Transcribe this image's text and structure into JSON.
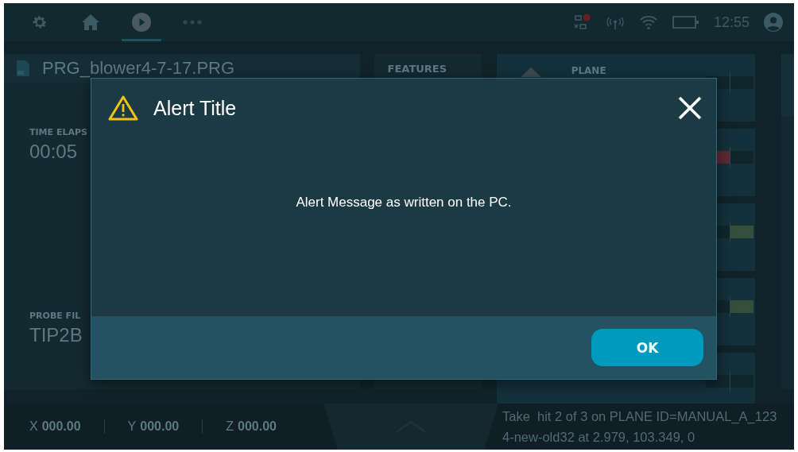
{
  "nav_tabs": [
    {
      "kind": "settings",
      "selected": false
    },
    {
      "kind": "home",
      "selected": false
    },
    {
      "kind": "run",
      "selected": true
    },
    {
      "kind": "more",
      "selected": false
    }
  ],
  "status": {
    "network_alert": true,
    "time": "12:55"
  },
  "program": {
    "file_name": "PRG_blower4-7-17.PRG",
    "time_label": "TIME ELAPS",
    "time_value": "00:05",
    "probe_label": "PROBE FIL",
    "probe_value": "TIP2B"
  },
  "features": {
    "heading": "FEATURES"
  },
  "feature_cards": [
    {
      "kind": "plain",
      "label": "PLANE",
      "arrow": true
    },
    {
      "kind": "low",
      "color": "#5a2a30"
    },
    {
      "kind": "high",
      "color": "#34503c"
    },
    {
      "kind": "high",
      "color": "#34503c"
    },
    {
      "kind": "plain"
    }
  ],
  "coordinates": [
    {
      "axis": "X",
      "value": "000.00"
    },
    {
      "axis": "Y",
      "value": "000.00"
    },
    {
      "axis": "Z",
      "value": "000.00"
    }
  ],
  "message": "Take  hit 2 of 3 on PLANE ID=MANUAL_A_1234-new-old32 at 2.979, 103.349, 0",
  "dialog": {
    "title": "Alert Title",
    "message": "Alert Message as written on the PC.",
    "buttons": [
      "OK"
    ]
  }
}
